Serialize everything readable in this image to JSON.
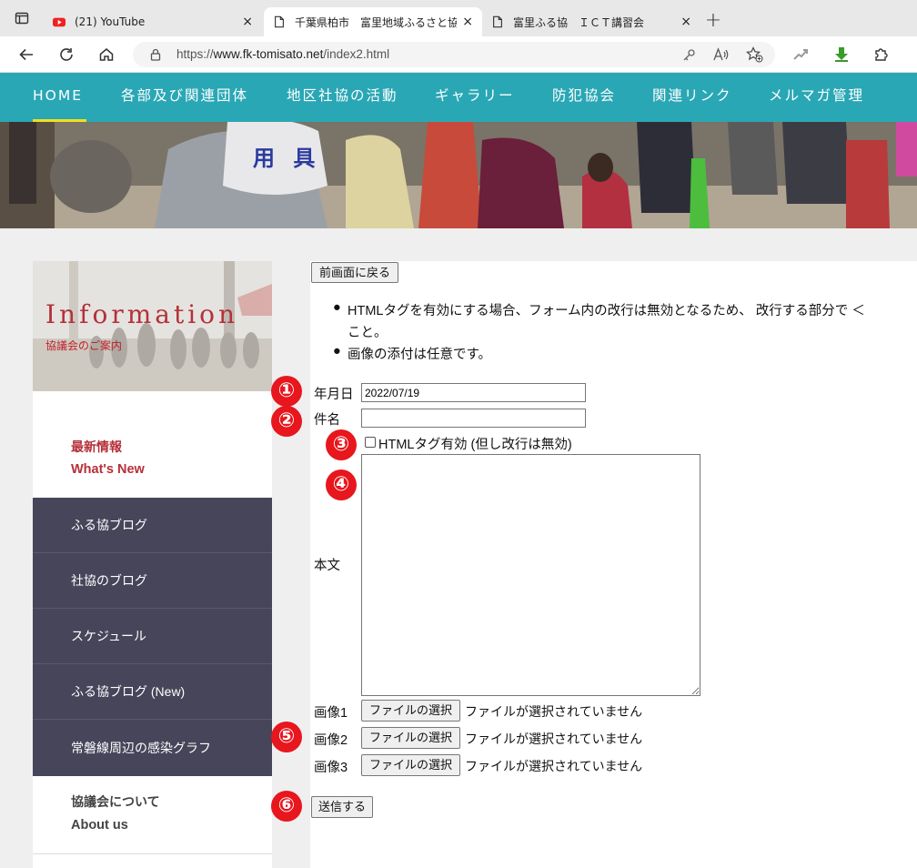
{
  "browser": {
    "tabs": [
      {
        "title": "(21) YouTube",
        "icon": "youtube-icon"
      },
      {
        "title": "千葉県柏市　富里地域ふるさと協議",
        "icon": "page-icon"
      },
      {
        "title": "富里ふる協　ＩＣＴ講習会",
        "icon": "page-icon"
      }
    ],
    "new_tab": "+",
    "close": "×",
    "url_prefix": "https://",
    "url_domain": "www.fk-tomisato.net",
    "url_path": "/index2.html"
  },
  "nav": {
    "items": [
      "HOME",
      "各部及び関連団体",
      "地区社協の活動",
      "ギャラリー",
      "防犯協会",
      "関連リンク",
      "メルマガ管理"
    ]
  },
  "hero": {
    "vest_text": "用 具"
  },
  "sidebar": {
    "info_title": "Information",
    "info_subtitle": "協議会のご案内",
    "whats_new_jp": "最新情報",
    "whats_new_en": "What's New",
    "menu": [
      "ふる協ブログ",
      "社協のブログ",
      "スケジュール",
      "ふる協ブログ (New)",
      "常磐線周辺の感染グラフ"
    ],
    "about_jp": "協議会について",
    "about_en": "About us"
  },
  "form": {
    "back_button": "前画面に戻る",
    "notes": [
      "HTMLタグを有効にする場合、フォーム内の改行は無効となるため、 改行する部分で ＜",
      "こと。",
      "画像の添付は任意です。"
    ],
    "date_label": "年月日",
    "date_value": "2022/07/19",
    "subject_label": "件名",
    "subject_value": "",
    "html_checkbox_label": "HTMLタグ有効 (但し改行は無効)",
    "body_label": "本文",
    "images": [
      {
        "label": "画像1",
        "button": "ファイルの選択",
        "status": "ファイルが選択されていません"
      },
      {
        "label": "画像2",
        "button": "ファイルの選択",
        "status": "ファイルが選択されていません"
      },
      {
        "label": "画像3",
        "button": "ファイルの選択",
        "status": "ファイルが選択されていません"
      }
    ],
    "submit": "送信する"
  },
  "annotations": [
    "①",
    "②",
    "③",
    "④",
    "⑤",
    "⑥"
  ],
  "colors": {
    "nav": "#2aa7b5",
    "sidebar_dark": "#46455a",
    "accent_red": "#b5303a",
    "annotation": "#e8161d",
    "home_underline": "#f0e020"
  }
}
